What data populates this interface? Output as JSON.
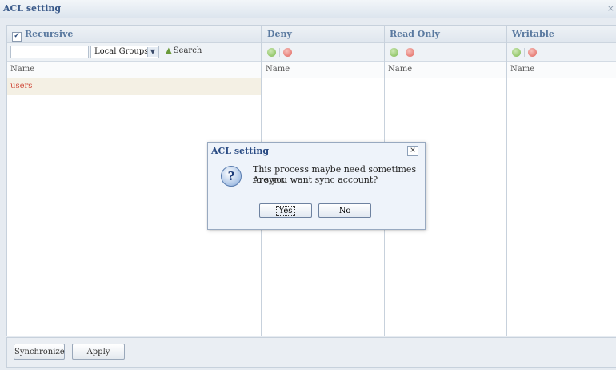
{
  "window": {
    "title": "ACL setting",
    "close": "×"
  },
  "left": {
    "recursive_label": "Recursive",
    "recursive_checked": true,
    "search_value": "",
    "group_select": "Local Groups",
    "search_label": "Search",
    "col_header": "Name",
    "rows": [
      "users"
    ]
  },
  "columns": [
    {
      "title": "Deny",
      "col_header": "Name"
    },
    {
      "title": "Read Only",
      "col_header": "Name"
    },
    {
      "title": "Writable",
      "col_header": "Name"
    }
  ],
  "bottom": {
    "sync_label": "Synchronize",
    "apply_label": "Apply"
  },
  "dialog": {
    "title": "ACL setting",
    "close": "×",
    "icon": "question-icon",
    "line1": "This process maybe need sometimes to sync.",
    "line2": "Are you want sync account?",
    "yes_label": "Yes",
    "no_label": "No"
  }
}
